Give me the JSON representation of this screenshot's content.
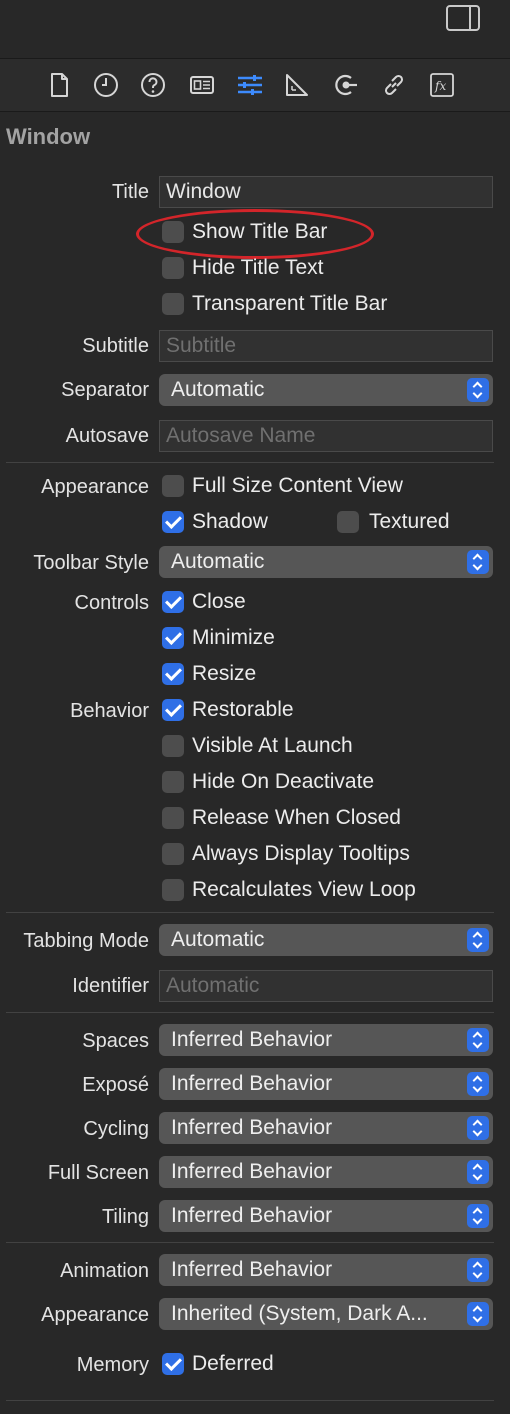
{
  "toolbar_icons": [
    {
      "name": "file-inspector-icon"
    },
    {
      "name": "history-inspector-icon"
    },
    {
      "name": "quick-help-inspector-icon"
    },
    {
      "name": "identity-inspector-icon"
    },
    {
      "name": "attributes-inspector-icon",
      "active": true
    },
    {
      "name": "size-inspector-icon"
    },
    {
      "name": "connections-inspector-icon"
    },
    {
      "name": "bindings-inspector-icon"
    },
    {
      "name": "view-effects-inspector-icon"
    }
  ],
  "section": {
    "title": "Window"
  },
  "title_field": {
    "label": "Title",
    "value": "Window"
  },
  "title_options": [
    {
      "label": "Show Title Bar",
      "checked": false
    },
    {
      "label": "Hide Title Text",
      "checked": false
    },
    {
      "label": "Transparent Title Bar",
      "checked": false
    }
  ],
  "subtitle": {
    "label": "Subtitle",
    "placeholder": "Subtitle"
  },
  "separator": {
    "label": "Separator",
    "value": "Automatic"
  },
  "autosave": {
    "label": "Autosave",
    "placeholder": "Autosave Name"
  },
  "appearance_group": {
    "label": "Appearance",
    "full_size": {
      "label": "Full Size Content View",
      "checked": false
    },
    "shadow": {
      "label": "Shadow",
      "checked": true
    },
    "textured": {
      "label": "Textured",
      "checked": false
    }
  },
  "toolbar_style": {
    "label": "Toolbar Style",
    "value": "Automatic"
  },
  "controls": {
    "label": "Controls",
    "items": [
      {
        "label": "Close",
        "checked": true
      },
      {
        "label": "Minimize",
        "checked": true
      },
      {
        "label": "Resize",
        "checked": true
      }
    ]
  },
  "behavior": {
    "label": "Behavior",
    "items": [
      {
        "label": "Restorable",
        "checked": true
      },
      {
        "label": "Visible At Launch",
        "checked": false
      },
      {
        "label": "Hide On Deactivate",
        "checked": false
      },
      {
        "label": "Release When Closed",
        "checked": false
      },
      {
        "label": "Always Display Tooltips",
        "checked": false
      },
      {
        "label": "Recalculates View Loop",
        "checked": false
      }
    ]
  },
  "tabbing_mode": {
    "label": "Tabbing Mode",
    "value": "Automatic"
  },
  "identifier": {
    "label": "Identifier",
    "placeholder": "Automatic"
  },
  "spaces": {
    "label": "Spaces",
    "value": "Inferred Behavior"
  },
  "expose": {
    "label": "Exposé",
    "value": "Inferred Behavior"
  },
  "cycling": {
    "label": "Cycling",
    "value": "Inferred Behavior"
  },
  "full_screen": {
    "label": "Full Screen",
    "value": "Inferred Behavior"
  },
  "tiling": {
    "label": "Tiling",
    "value": "Inferred Behavior"
  },
  "animation": {
    "label": "Animation",
    "value": "Inferred Behavior"
  },
  "appearance_popup": {
    "label": "Appearance",
    "value": "Inherited (System, Dark A..."
  },
  "memory": {
    "label": "Memory",
    "option": {
      "label": "Deferred",
      "checked": true
    }
  },
  "colors": {
    "accent": "#2f6fe6",
    "annotation": "#d3252a",
    "background": "#282828"
  }
}
